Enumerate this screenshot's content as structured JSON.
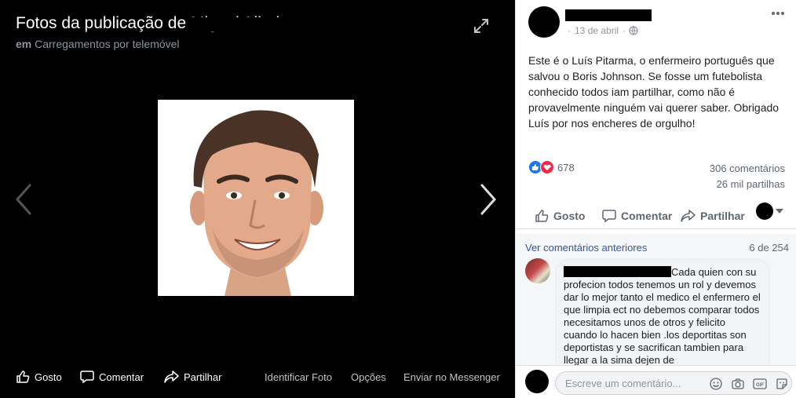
{
  "viewer": {
    "title": "Fotos da publicação de Miguel Albeiro",
    "album_prefix": "em",
    "album_name": "Carregamentos por telemóvel",
    "actions": {
      "like": "Gosto",
      "comment": "Comentar",
      "share": "Partilhar",
      "tag": "Identificar Foto",
      "options": "Opções",
      "messenger": "Enviar no Messenger"
    },
    "icons": [
      "expand-icon",
      "chevron-left-icon",
      "chevron-right-icon",
      "like-icon",
      "comment-icon",
      "share-icon"
    ]
  },
  "post": {
    "date": "13 de abril",
    "separator": "·",
    "text": "Este é o Luís Pitarma, o enfermeiro português que salvou o Boris Johnson. Se fosse um futebolista conhecido todos iam partilhar, como não é provavelmente ninguém vai querer saber. Obrigado Luís por nos encheres de orgulho!",
    "reaction_count": "678",
    "comments_count": "306 comentários",
    "shares_count": "26 mil partilhas",
    "actions": {
      "like": "Gosto",
      "comment": "Comentar",
      "share": "Partilhar"
    },
    "colors": {
      "like": "#1877f2",
      "love": "#f0284a",
      "link": "#385898"
    }
  },
  "comments": {
    "view_previous": "Ver comentários anteriores",
    "pager": "6 de 254",
    "items": [
      {
        "text": "Cada quien con su profecion todos tenemos un rol y devemos dar lo mejor tanto el medico el enfermero el que limpia ect no debemos comparar todos necesitamos unos de otros y felicito cuando lo hacen bien .los deportitas son deportistas y se sacrifican tambien para llegar a la sima dejen de"
      }
    ]
  },
  "composer": {
    "placeholder": "Escreve um comentário...",
    "icons": [
      "emoji-icon",
      "camera-icon",
      "gif-icon",
      "sticker-icon"
    ]
  }
}
